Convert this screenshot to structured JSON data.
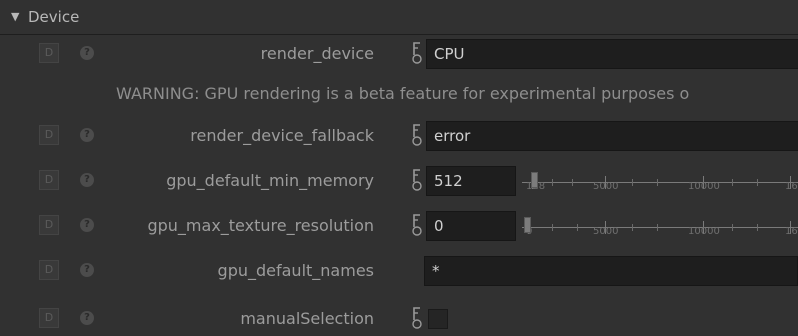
{
  "section": {
    "title": "Device",
    "arrow": "▼"
  },
  "controls": {
    "d_button": "D",
    "help": "?"
  },
  "render_device": {
    "label": "render_device",
    "value": "CPU"
  },
  "warning": "WARNING: GPU rendering is a beta feature for experimental purposes o",
  "render_device_fallback": {
    "label": "render_device_fallback",
    "value": "error"
  },
  "gpu_default_min_memory": {
    "label": "gpu_default_min_memory",
    "value": "512",
    "slider": {
      "ticks": [
        "128",
        "5000",
        "10000",
        "16"
      ]
    }
  },
  "gpu_max_texture_resolution": {
    "label": "gpu_max_texture_resolution",
    "value": "0",
    "slider": {
      "ticks": [
        "0",
        "5000",
        "10000",
        "16"
      ]
    }
  },
  "gpu_default_names": {
    "label": "gpu_default_names",
    "value": "*"
  },
  "manualSelection": {
    "label": "manualSelection",
    "checked": false
  },
  "icons": {
    "collapse": "triangle-down-icon",
    "animation": "animation-curve-icon",
    "help": "question-circle-icon"
  }
}
